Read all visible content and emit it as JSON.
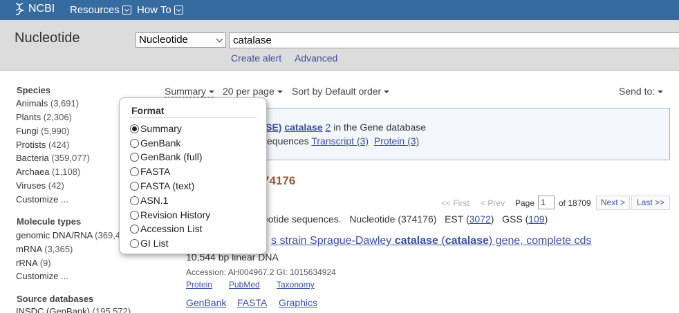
{
  "header": {
    "logo_text": "NCBI",
    "menus": [
      "Resources",
      "How To"
    ]
  },
  "search": {
    "db_title": "Nucleotide",
    "db_select_value": "Nucleotide",
    "query": "catalase",
    "create_alert": "Create alert",
    "advanced": "Advanced"
  },
  "filters": {
    "species_title": "Species",
    "species": [
      {
        "label": "Animals",
        "count": "(3,691)"
      },
      {
        "label": "Plants",
        "count": "(2,306)"
      },
      {
        "label": "Fungi",
        "count": "(5,990)"
      },
      {
        "label": "Protists",
        "count": "(424)"
      },
      {
        "label": "Bacteria",
        "count": "(359,077)"
      },
      {
        "label": "Archaea",
        "count": "(1,108)"
      },
      {
        "label": "Viruses",
        "count": "(42)"
      }
    ],
    "customize": "Customize ...",
    "molecule_title": "Molecule types",
    "molecules": [
      {
        "label": "genomic DNA/RNA",
        "count": "(369,4"
      },
      {
        "label": "mRNA",
        "count": "(3,365)"
      },
      {
        "label": "rRNA",
        "count": "(9)"
      }
    ],
    "source_title": "Source databases",
    "sources": [
      {
        "label": "INSDC (GenBank)",
        "count": "(195,572)"
      }
    ]
  },
  "display": {
    "summary": "Summary",
    "per_page": "20 per page",
    "sort": "Sort by Default order",
    "send_to": "Send to:"
  },
  "format_popup": {
    "title": "Format",
    "options": [
      "Summary",
      "GenBank",
      "GenBank (full)",
      "FASTA",
      "FASTA (text)",
      "ASN.1",
      "Revision History",
      "Accession List",
      "GI List"
    ],
    "selected": "Summary"
  },
  "gene_box": {
    "prefix": "ASE)",
    "gene_link": "catalase",
    "gene_num": "2",
    "suffix": "in the Gene database",
    "seq_prefix": "equences",
    "transcript_link": "Transcript (3)",
    "protein_link": "Protein (3)"
  },
  "results": {
    "count_fragment": "74176",
    "found_prefix": "eotide sequences.",
    "nucleotide": "Nucleotide (374176)",
    "est_label": "EST (",
    "est_link": "3072",
    "est_close": ")",
    "gss_label": "GSS (",
    "gss_link": "109",
    "gss_close": ")",
    "pager": {
      "first": "<< First",
      "prev": "< Prev",
      "page_label": "Page",
      "page_value": "1",
      "of": "of 18709",
      "next": "Next >",
      "last": "Last >>"
    },
    "item": {
      "title_pre": "s strain Sprague-Dawley ",
      "title_b1": "catalase",
      "title_mid": " (",
      "title_b2": "catalase",
      "title_post": ") gene, complete cds",
      "desc": "10,544 bp linear DNA",
      "accession": "Accession: AH004967.2   GI: 1015634924",
      "links1": [
        "Protein",
        "PubMed",
        "Taxonomy"
      ],
      "links2": [
        "GenBank",
        "FASTA",
        "Graphics"
      ]
    }
  }
}
